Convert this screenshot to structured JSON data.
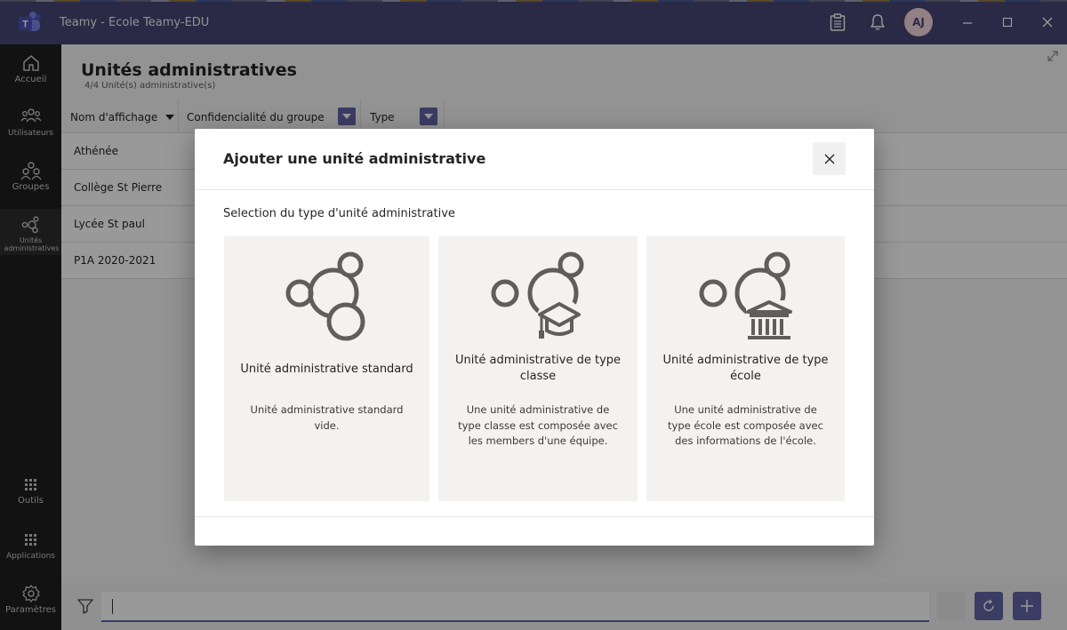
{
  "app": {
    "title": "Teamy - Ecole Teamy-EDU",
    "avatar_initials": "AJ"
  },
  "rail": {
    "items": [
      {
        "label": "Accueil"
      },
      {
        "label": "Utilisateurs"
      },
      {
        "label": "Groupes"
      },
      {
        "label": "Unités administratives"
      },
      {
        "label": "Outils"
      },
      {
        "label": "Applications"
      },
      {
        "label": "Paramètres"
      }
    ]
  },
  "page": {
    "title": "Unités administratives",
    "subtitle": "4/4 Unité(s) administrative(s)",
    "columns": [
      "Nom d'affichage",
      "Confidencialité du groupe",
      "Type"
    ],
    "rows": [
      "Athénée",
      "Collège St Pierre",
      "Lycée St paul",
      "P1A 2020-2021"
    ]
  },
  "modal": {
    "title": "Ajouter une unité administrative",
    "section_label": "Selection du type d'unité administrative",
    "cards": [
      {
        "title": "Unité administrative standard",
        "description": "Unité administrative standard vide.",
        "icon": "circles-icon"
      },
      {
        "title": "Unité administrative de type classe",
        "description": "Une unité administrative de type classe est composée avec les members d'une équipe.",
        "icon": "circles-graduation-cap-icon"
      },
      {
        "title": "Unité administrative de type école",
        "description": "Une unité administrative de type école est composée avec des informations de l'école.",
        "icon": "circles-school-building-icon"
      }
    ]
  },
  "colors": {
    "titlebar": "#464775",
    "accent": "#6264a7",
    "rail": "#1f1f1f",
    "card": "#f3f2f1"
  }
}
